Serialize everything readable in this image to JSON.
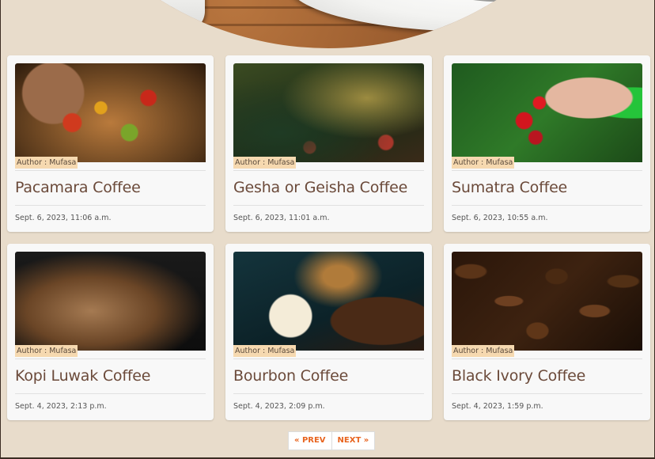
{
  "posts": [
    {
      "author": "Author : Mufasa",
      "title": "Pacamara Coffee",
      "date": "Sept. 6, 2023, 11:06 a.m.",
      "image_icon": "coffee-cherries-in-hand"
    },
    {
      "author": "Author : Mufasa",
      "title": "Gesha or Geisha Coffee",
      "date": "Sept. 6, 2023, 11:01 a.m.",
      "image_icon": "coffee-plants-field"
    },
    {
      "author": "Author : Mufasa",
      "title": "Sumatra Coffee",
      "date": "Sept. 6, 2023, 10:55 a.m.",
      "image_icon": "picking-red-cherries"
    },
    {
      "author": "Author : Mufasa",
      "title": "Kopi Luwak Coffee",
      "date": "Sept. 4, 2023, 2:13 p.m.",
      "image_icon": "roasting-beans"
    },
    {
      "author": "Author : Mufasa",
      "title": "Bourbon Coffee",
      "date": "Sept. 4, 2023, 2:09 p.m.",
      "image_icon": "grinder-and-cup"
    },
    {
      "author": "Author : Mufasa",
      "title": "Black Ivory Coffee",
      "date": "Sept. 4, 2023, 1:59 p.m.",
      "image_icon": "roasted-beans-closeup"
    }
  ],
  "pagination": {
    "prev": "« PREV",
    "next": "NEXT »"
  },
  "colors": {
    "background": "#e8dccb",
    "accent": "#e8641f",
    "title": "#6b4a3a",
    "author_badge": "#f6d9b0"
  }
}
